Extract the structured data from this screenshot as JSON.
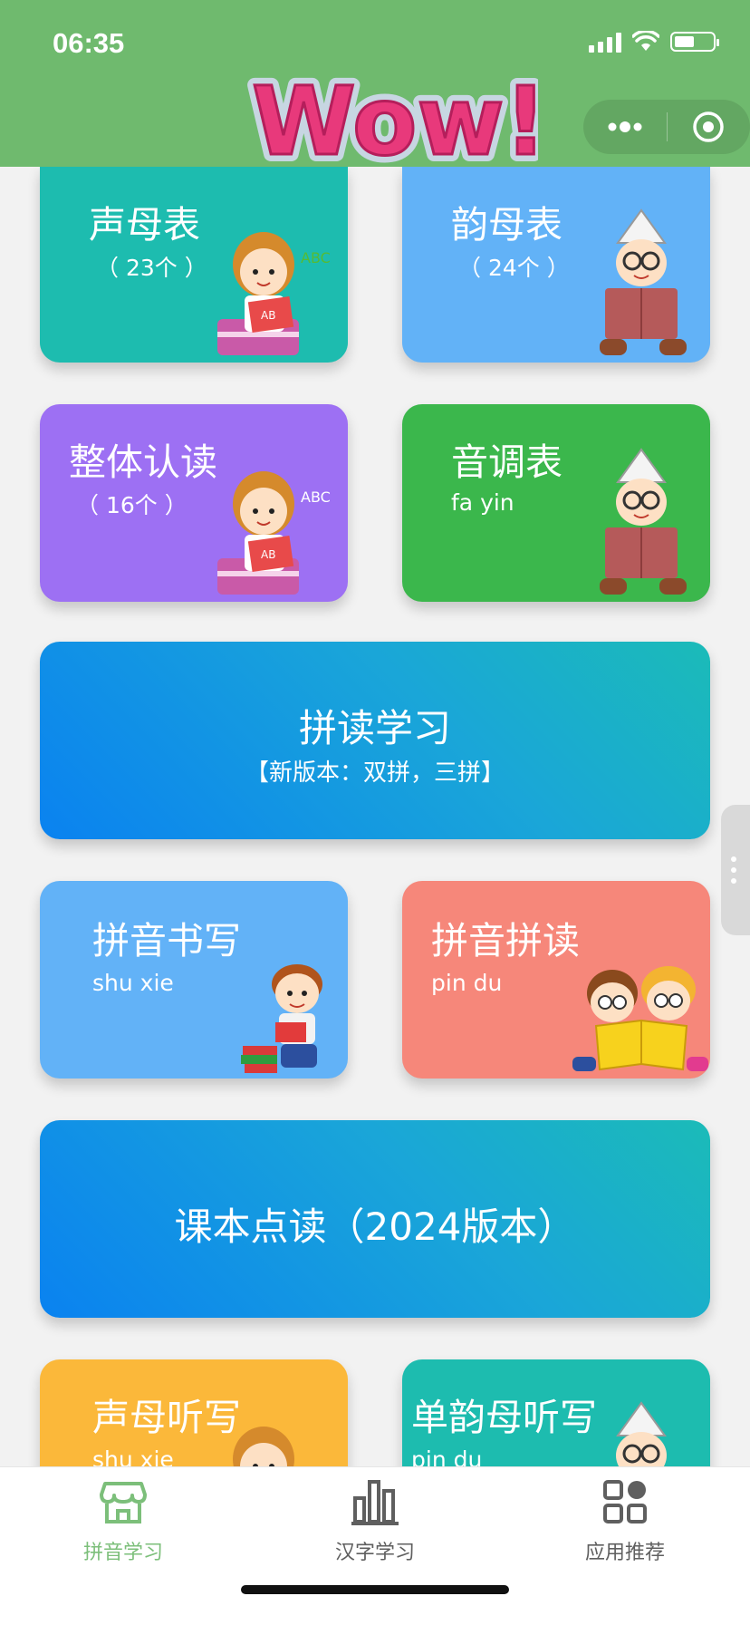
{
  "status_bar": {
    "time": "06:35"
  },
  "header": {
    "banner_text": "Wow!"
  },
  "cards": {
    "shengmu": {
      "title": "声母表",
      "sub": "（ 23个 ）"
    },
    "yunmu": {
      "title": "韵母表",
      "sub": "（ 24个 ）"
    },
    "zhengti": {
      "title": "整体认读",
      "sub": "（ 16个 ）"
    },
    "yindiao": {
      "title": "音调表",
      "sub": "fa yin"
    },
    "pindu_xuexi": {
      "title": "拼读学习",
      "sub": "【新版本：双拼，三拼】"
    },
    "shuxie": {
      "title": "拼音书写",
      "sub": "shu xie"
    },
    "pinyin_pindu": {
      "title": "拼音拼读",
      "sub": "pin du"
    },
    "keben": {
      "title": "课本点读（2024版本）"
    },
    "shengmu_tingxie": {
      "title": "声母听写",
      "sub": "shu xie"
    },
    "danyunmu_tingxie": {
      "title": "单韵母听写",
      "sub": "pin du"
    }
  },
  "tabs": [
    {
      "label": "拼音学习",
      "icon": "store-icon",
      "active": true
    },
    {
      "label": "汉字学习",
      "icon": "bar-chart-icon",
      "active": false
    },
    {
      "label": "应用推荐",
      "icon": "apps-grid-icon",
      "active": false
    }
  ],
  "colors": {
    "header": "#6fba6e",
    "teal": "#1dbcaf",
    "blue_light": "#62b2f7",
    "purple": "#9d70f3",
    "green": "#3bb74c",
    "salmon": "#f6877a",
    "yellow": "#fbb83a",
    "tab_active": "#7cbf7a",
    "tab_inactive": "#5f5f5f"
  }
}
